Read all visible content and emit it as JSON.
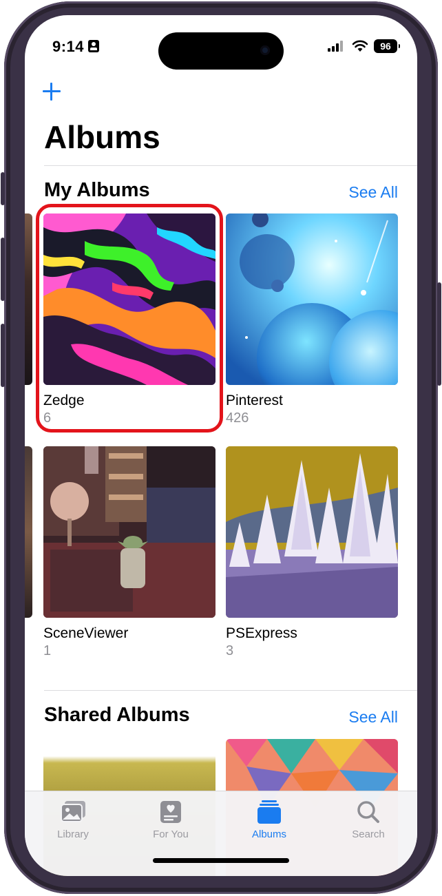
{
  "status_bar": {
    "time": "9:14",
    "battery": "96"
  },
  "header": {
    "title": "Albums"
  },
  "my_albums": {
    "title": "My Albums",
    "see_all": "See All",
    "items": [
      {
        "name": "Zedge",
        "count": "6"
      },
      {
        "name": "Pinterest",
        "count": "426"
      },
      {
        "name": "SceneViewer",
        "count": "1"
      },
      {
        "name": "PSExpress",
        "count": "3"
      }
    ]
  },
  "shared_albums": {
    "title": "Shared Albums",
    "see_all": "See All"
  },
  "tabbar": {
    "tabs": [
      {
        "label": "Library",
        "icon": "photo-library-icon",
        "active": false
      },
      {
        "label": "For You",
        "icon": "for-you-icon",
        "active": false
      },
      {
        "label": "Albums",
        "icon": "albums-stack-icon",
        "active": true
      },
      {
        "label": "Search",
        "icon": "magnifier-icon",
        "active": false
      }
    ]
  },
  "colors": {
    "accent": "#1a7cf0",
    "highlight": "#e3141b",
    "secondary_text": "#8e8e93"
  }
}
